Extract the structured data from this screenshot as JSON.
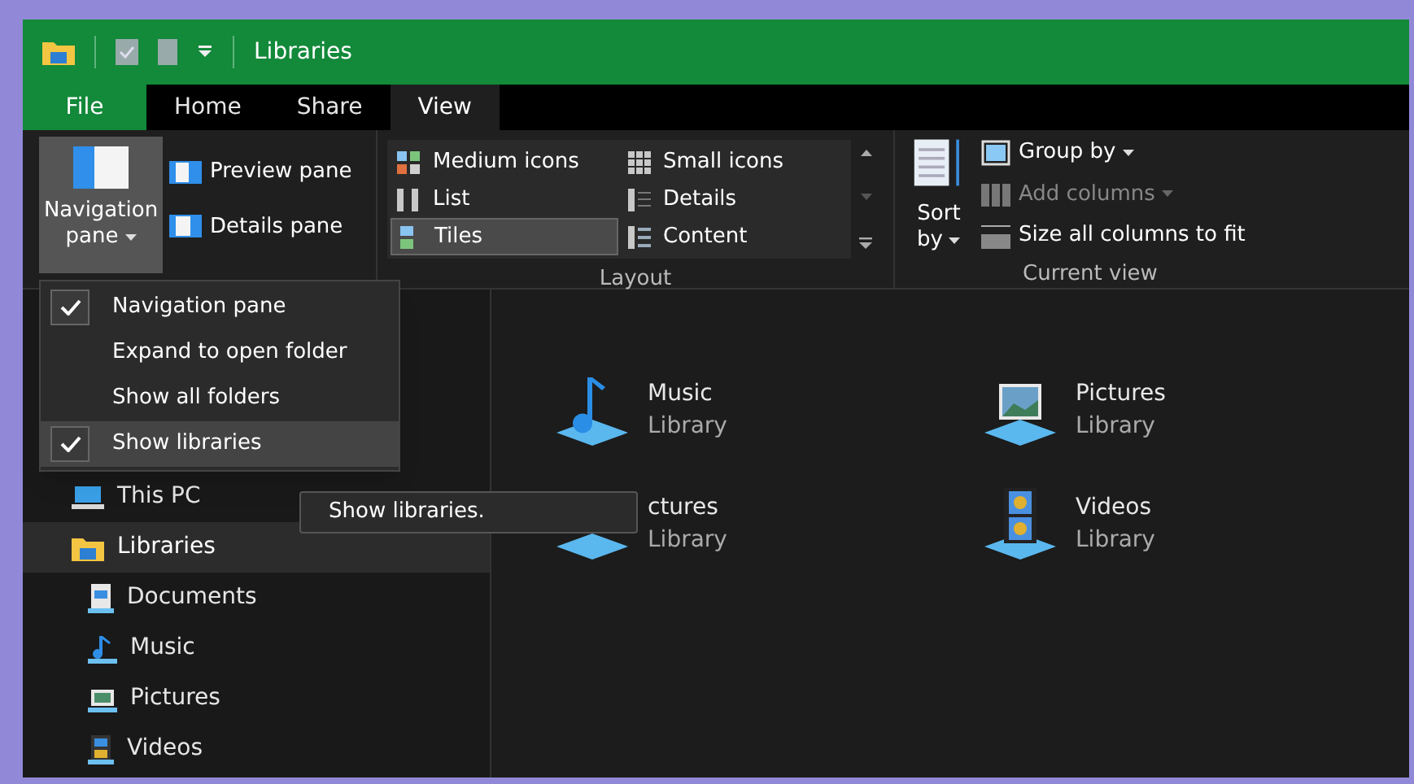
{
  "window": {
    "title": "Libraries"
  },
  "tabs": [
    {
      "label": "File",
      "kind": "file",
      "selected": false
    },
    {
      "label": "Home",
      "kind": "tab",
      "selected": false
    },
    {
      "label": "Share",
      "kind": "tab",
      "selected": false
    },
    {
      "label": "View",
      "kind": "tab",
      "selected": true
    }
  ],
  "ribbon": {
    "panes": {
      "navigation_pane": {
        "label": "Navigation",
        "label_2": "pane",
        "expanded": true
      },
      "buttons": [
        {
          "label": "Preview pane",
          "kind": "preview"
        },
        {
          "label": "Details pane",
          "kind": "details"
        }
      ]
    },
    "layout": {
      "label": "Layout",
      "options": [
        {
          "label": "Medium icons",
          "kind": "medium",
          "selected": false
        },
        {
          "label": "Small icons",
          "kind": "small",
          "selected": false
        },
        {
          "label": "List",
          "kind": "list",
          "selected": false
        },
        {
          "label": "Details",
          "kind": "details",
          "selected": false
        },
        {
          "label": "Tiles",
          "kind": "tiles",
          "selected": true
        },
        {
          "label": "Content",
          "kind": "content",
          "selected": false
        }
      ]
    },
    "current_view": {
      "label": "Current view",
      "sort": {
        "label": "Sort",
        "label_2": "by"
      },
      "items": [
        {
          "label": "Group by",
          "kind": "group",
          "disabled": false,
          "caret": true
        },
        {
          "label": "Add columns",
          "kind": "columns",
          "disabled": true,
          "caret": true
        },
        {
          "label": "Size all columns to fit",
          "kind": "fit",
          "disabled": false,
          "caret": false
        }
      ]
    }
  },
  "navigation_menu": [
    {
      "label": "Navigation pane",
      "checked": true,
      "selected": false
    },
    {
      "label": "Expand to open folder",
      "checked": false,
      "selected": false
    },
    {
      "label": "Show all folders",
      "checked": false,
      "selected": false
    },
    {
      "label": "Show libraries",
      "checked": true,
      "selected": true
    }
  ],
  "tooltip": "Show libraries.",
  "nav_pane": [
    {
      "label": "This PC",
      "kind": "pc",
      "selected": false
    },
    {
      "label": "Libraries",
      "kind": "libraries",
      "selected": true,
      "children": [
        {
          "label": "Documents",
          "kind": "documents",
          "selected": false
        },
        {
          "label": "Music",
          "kind": "music",
          "selected": false
        },
        {
          "label": "Pictures",
          "kind": "pictures",
          "selected": false
        },
        {
          "label": "Videos",
          "kind": "videos",
          "selected": false
        }
      ]
    }
  ],
  "libraries": [
    {
      "name": "Music",
      "subtitle": "Library",
      "kind": "music"
    },
    {
      "name": "Pictures",
      "subtitle": "Library",
      "kind": "pictures"
    },
    {
      "name": "ctures",
      "subtitle": "Library",
      "kind": "plain"
    },
    {
      "name": "Videos",
      "subtitle": "Library",
      "kind": "videos"
    }
  ]
}
